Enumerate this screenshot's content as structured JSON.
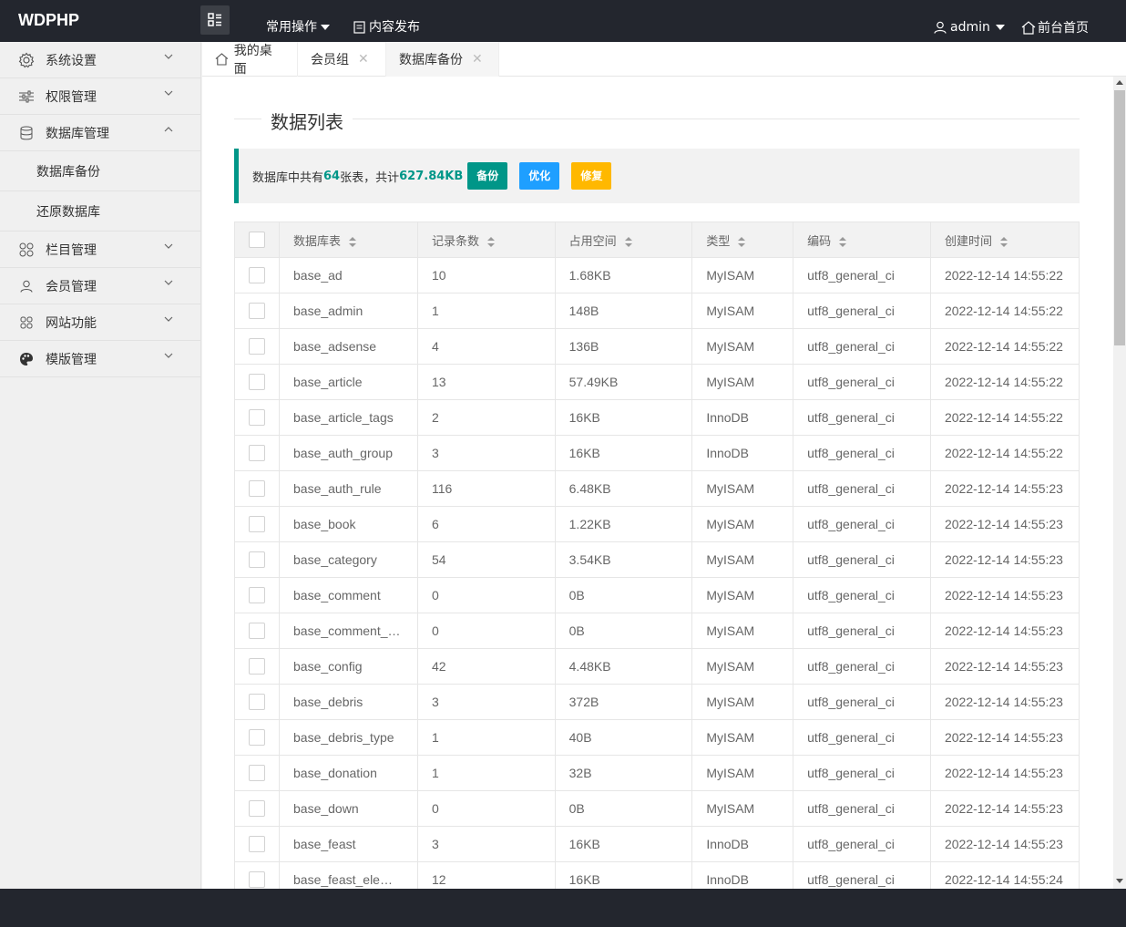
{
  "app": {
    "logo": "WDPHP"
  },
  "topnav": {
    "common_ops": "常用操作",
    "publish": "内容发布",
    "user": "admin",
    "home": "前台首页"
  },
  "sidebar": {
    "items": [
      {
        "label": "系统设置",
        "icon": "gear-icon"
      },
      {
        "label": "权限管理",
        "icon": "sliders-icon"
      },
      {
        "label": "数据库管理",
        "icon": "database-icon"
      },
      {
        "label": "栏目管理",
        "icon": "grid-icon"
      },
      {
        "label": "会员管理",
        "icon": "user-icon"
      },
      {
        "label": "网站功能",
        "icon": "apps-icon"
      },
      {
        "label": "模版管理",
        "icon": "palette-icon"
      }
    ],
    "sub": [
      "数据库备份",
      "还原数据库"
    ]
  },
  "tabs": [
    {
      "label": "我的桌面"
    },
    {
      "label": "会员组"
    },
    {
      "label": "数据库备份"
    }
  ],
  "main": {
    "title": "数据列表",
    "summary_pre": "数据库中共有",
    "table_count": "64",
    "summary_mid": "张表，共计",
    "total_size": "627.84KB",
    "btn_backup": "备份",
    "btn_optimize": "优化",
    "btn_repair": "修复"
  },
  "table": {
    "headers": [
      "数据库表",
      "记录条数",
      "占用空间",
      "类型",
      "编码",
      "创建时间"
    ],
    "rows": [
      [
        "base_ad",
        "10",
        "1.68KB",
        "MyISAM",
        "utf8_general_ci",
        "2022-12-14 14:55:22"
      ],
      [
        "base_admin",
        "1",
        "148B",
        "MyISAM",
        "utf8_general_ci",
        "2022-12-14 14:55:22"
      ],
      [
        "base_adsense",
        "4",
        "136B",
        "MyISAM",
        "utf8_general_ci",
        "2022-12-14 14:55:22"
      ],
      [
        "base_article",
        "13",
        "57.49KB",
        "MyISAM",
        "utf8_general_ci",
        "2022-12-14 14:55:22"
      ],
      [
        "base_article_tags",
        "2",
        "16KB",
        "InnoDB",
        "utf8_general_ci",
        "2022-12-14 14:55:22"
      ],
      [
        "base_auth_group",
        "3",
        "16KB",
        "InnoDB",
        "utf8_general_ci",
        "2022-12-14 14:55:22"
      ],
      [
        "base_auth_rule",
        "116",
        "6.48KB",
        "MyISAM",
        "utf8_general_ci",
        "2022-12-14 14:55:23"
      ],
      [
        "base_book",
        "6",
        "1.22KB",
        "MyISAM",
        "utf8_general_ci",
        "2022-12-14 14:55:23"
      ],
      [
        "base_category",
        "54",
        "3.54KB",
        "MyISAM",
        "utf8_general_ci",
        "2022-12-14 14:55:23"
      ],
      [
        "base_comment",
        "0",
        "0B",
        "MyISAM",
        "utf8_general_ci",
        "2022-12-14 14:55:23"
      ],
      [
        "base_comment_…",
        "0",
        "0B",
        "MyISAM",
        "utf8_general_ci",
        "2022-12-14 14:55:23"
      ],
      [
        "base_config",
        "42",
        "4.48KB",
        "MyISAM",
        "utf8_general_ci",
        "2022-12-14 14:55:23"
      ],
      [
        "base_debris",
        "3",
        "372B",
        "MyISAM",
        "utf8_general_ci",
        "2022-12-14 14:55:23"
      ],
      [
        "base_debris_type",
        "1",
        "40B",
        "MyISAM",
        "utf8_general_ci",
        "2022-12-14 14:55:23"
      ],
      [
        "base_donation",
        "1",
        "32B",
        "MyISAM",
        "utf8_general_ci",
        "2022-12-14 14:55:23"
      ],
      [
        "base_down",
        "0",
        "0B",
        "MyISAM",
        "utf8_general_ci",
        "2022-12-14 14:55:23"
      ],
      [
        "base_feast",
        "3",
        "16KB",
        "InnoDB",
        "utf8_general_ci",
        "2022-12-14 14:55:23"
      ],
      [
        "base_feast_ele…",
        "12",
        "16KB",
        "InnoDB",
        "utf8_general_ci",
        "2022-12-14 14:55:24"
      ]
    ]
  }
}
